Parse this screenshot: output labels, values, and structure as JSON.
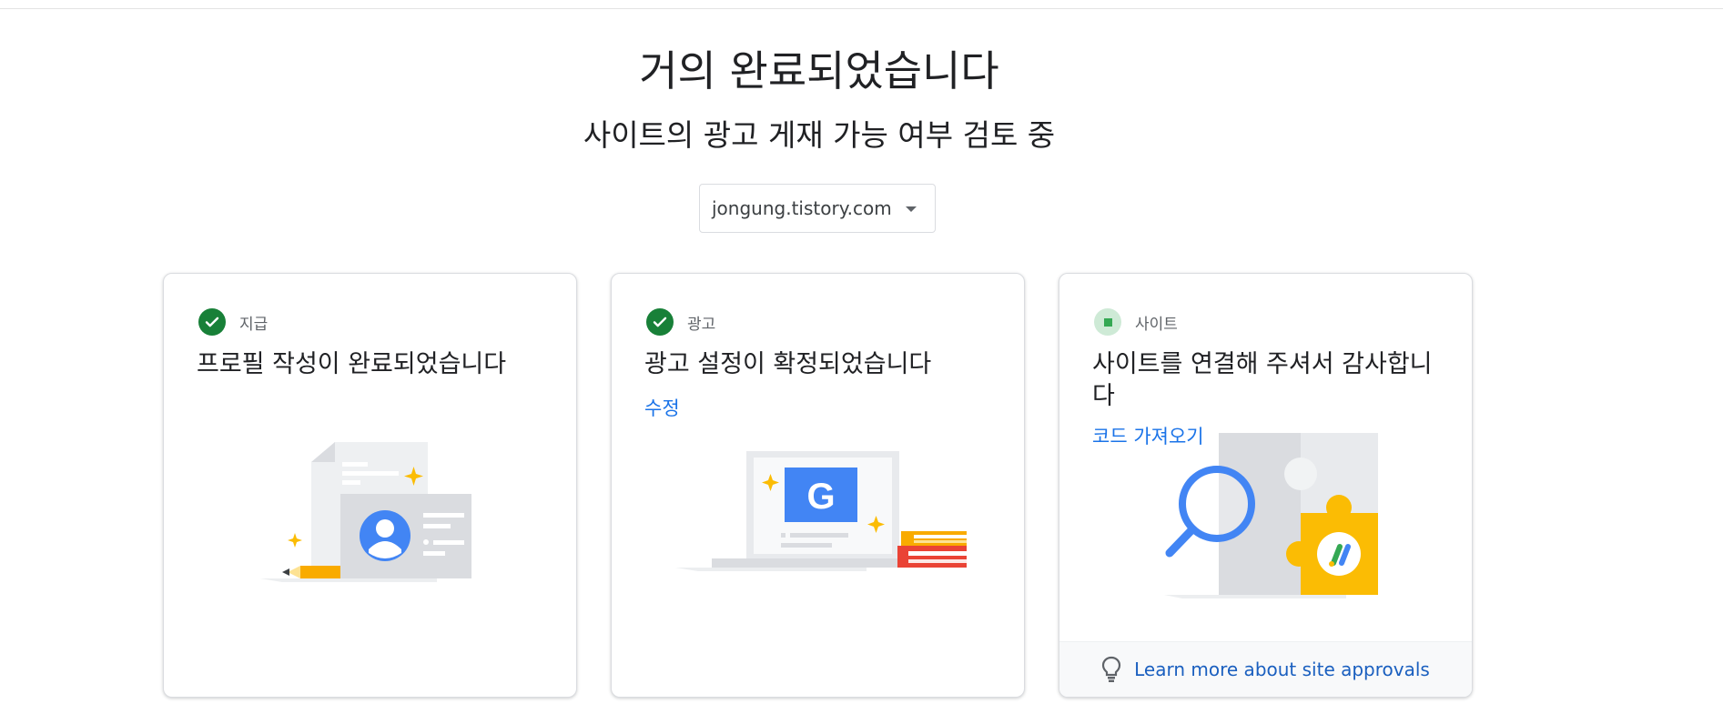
{
  "header": {
    "title": "거의 완료되었습니다",
    "subtitle": "사이트의 광고 게재 가능 여부 검토 중"
  },
  "site_selector": {
    "value": "jongung.tistory.com",
    "icon": "dropdown-caret-icon"
  },
  "cards": {
    "payment": {
      "status": "complete",
      "status_label": "지급",
      "heading": "프로필 작성이 완료되었습니다",
      "illustration": "profile-card-illustration"
    },
    "ads": {
      "status": "complete",
      "status_label": "광고",
      "heading": "광고 설정이 확정되었습니다",
      "link": "수정",
      "illustration": "laptop-google-illustration"
    },
    "site": {
      "status": "pending",
      "status_label": "사이트",
      "heading": "사이트를 연결해 주셔서 감사합니다",
      "link": "코드 가져오기",
      "illustration": "puzzle-magnifier-illustration",
      "footer_link": "Learn more about site approvals",
      "footer_icon": "lightbulb-icon"
    }
  },
  "colors": {
    "complete_green": "#188038",
    "pending_green": "#ceead6",
    "link_blue": "#1a73e8",
    "google_blue": "#4285f4",
    "yellow": "#fbbc04",
    "red": "#ea4335"
  }
}
